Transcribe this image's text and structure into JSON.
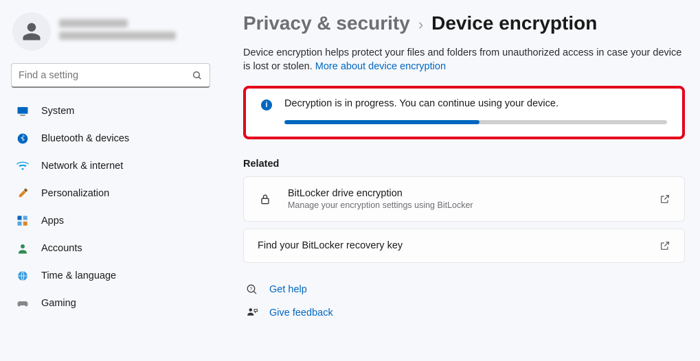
{
  "search": {
    "placeholder": "Find a setting"
  },
  "sidebar": {
    "items": [
      {
        "label": "System"
      },
      {
        "label": "Bluetooth & devices"
      },
      {
        "label": "Network & internet"
      },
      {
        "label": "Personalization"
      },
      {
        "label": "Apps"
      },
      {
        "label": "Accounts"
      },
      {
        "label": "Time & language"
      },
      {
        "label": "Gaming"
      }
    ]
  },
  "breadcrumb": {
    "parent": "Privacy & security",
    "current": "Device encryption"
  },
  "description": "Device encryption helps protect your files and folders from unauthorized access in case your device is lost or stolen.",
  "more_link": "More about device encryption",
  "alert": {
    "text": "Decryption is in progress. You can continue using your device.",
    "progress_percent": 51
  },
  "related": {
    "label": "Related",
    "items": [
      {
        "title": "BitLocker drive encryption",
        "subtitle": "Manage your encryption settings using BitLocker"
      },
      {
        "title": "Find your BitLocker recovery key",
        "subtitle": ""
      }
    ]
  },
  "footer": {
    "help": "Get help",
    "feedback": "Give feedback"
  },
  "colors": {
    "accent": "#0067c0",
    "highlight_border": "#e4001b"
  }
}
